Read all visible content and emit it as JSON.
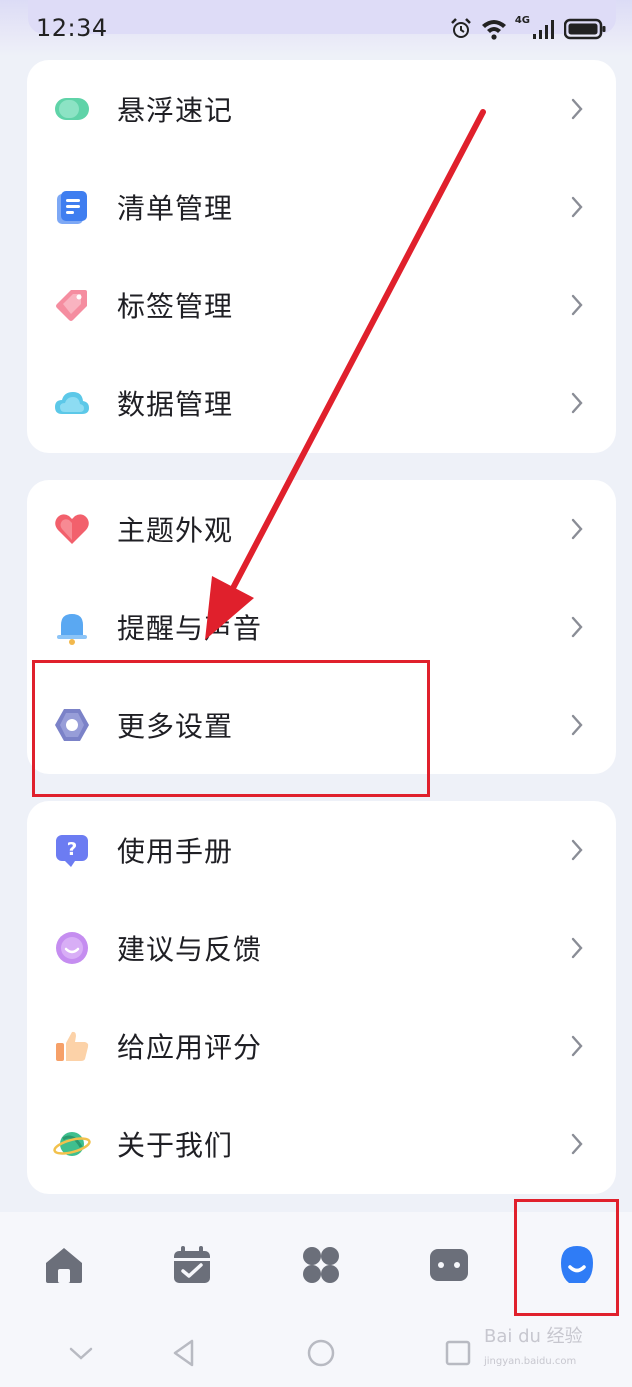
{
  "status": {
    "time": "12:34",
    "network": "4G"
  },
  "cards": [
    {
      "items": [
        {
          "label": "悬浮速记",
          "icon": "floating-note-icon"
        },
        {
          "label": "清单管理",
          "icon": "list-icon"
        },
        {
          "label": "标签管理",
          "icon": "tag-icon"
        },
        {
          "label": "数据管理",
          "icon": "cloud-icon"
        }
      ]
    },
    {
      "items": [
        {
          "label": "主题外观",
          "icon": "heart-icon"
        },
        {
          "label": "提醒与声音",
          "icon": "bell-icon"
        },
        {
          "label": "更多设置",
          "icon": "settings-hex-icon"
        }
      ]
    },
    {
      "items": [
        {
          "label": "使用手册",
          "icon": "help-icon"
        },
        {
          "label": "建议与反馈",
          "icon": "feedback-icon"
        },
        {
          "label": "给应用评分",
          "icon": "thumbs-up-icon"
        },
        {
          "label": "关于我们",
          "icon": "planet-icon"
        }
      ]
    }
  ],
  "tabs": [
    {
      "name": "home",
      "icon": "home-icon"
    },
    {
      "name": "calendar",
      "icon": "calendar-check-icon"
    },
    {
      "name": "apps",
      "icon": "grid-icon"
    },
    {
      "name": "messages",
      "icon": "chat-icon"
    },
    {
      "name": "profile",
      "icon": "profile-icon",
      "active": true
    }
  ],
  "colors": {
    "accent": "#2f7cf6",
    "annotation": "#e0202c",
    "tab_inactive": "#6b6f7a"
  },
  "watermark": {
    "main": "Bai du 经验",
    "sub": "jingyan.baidu.com"
  }
}
